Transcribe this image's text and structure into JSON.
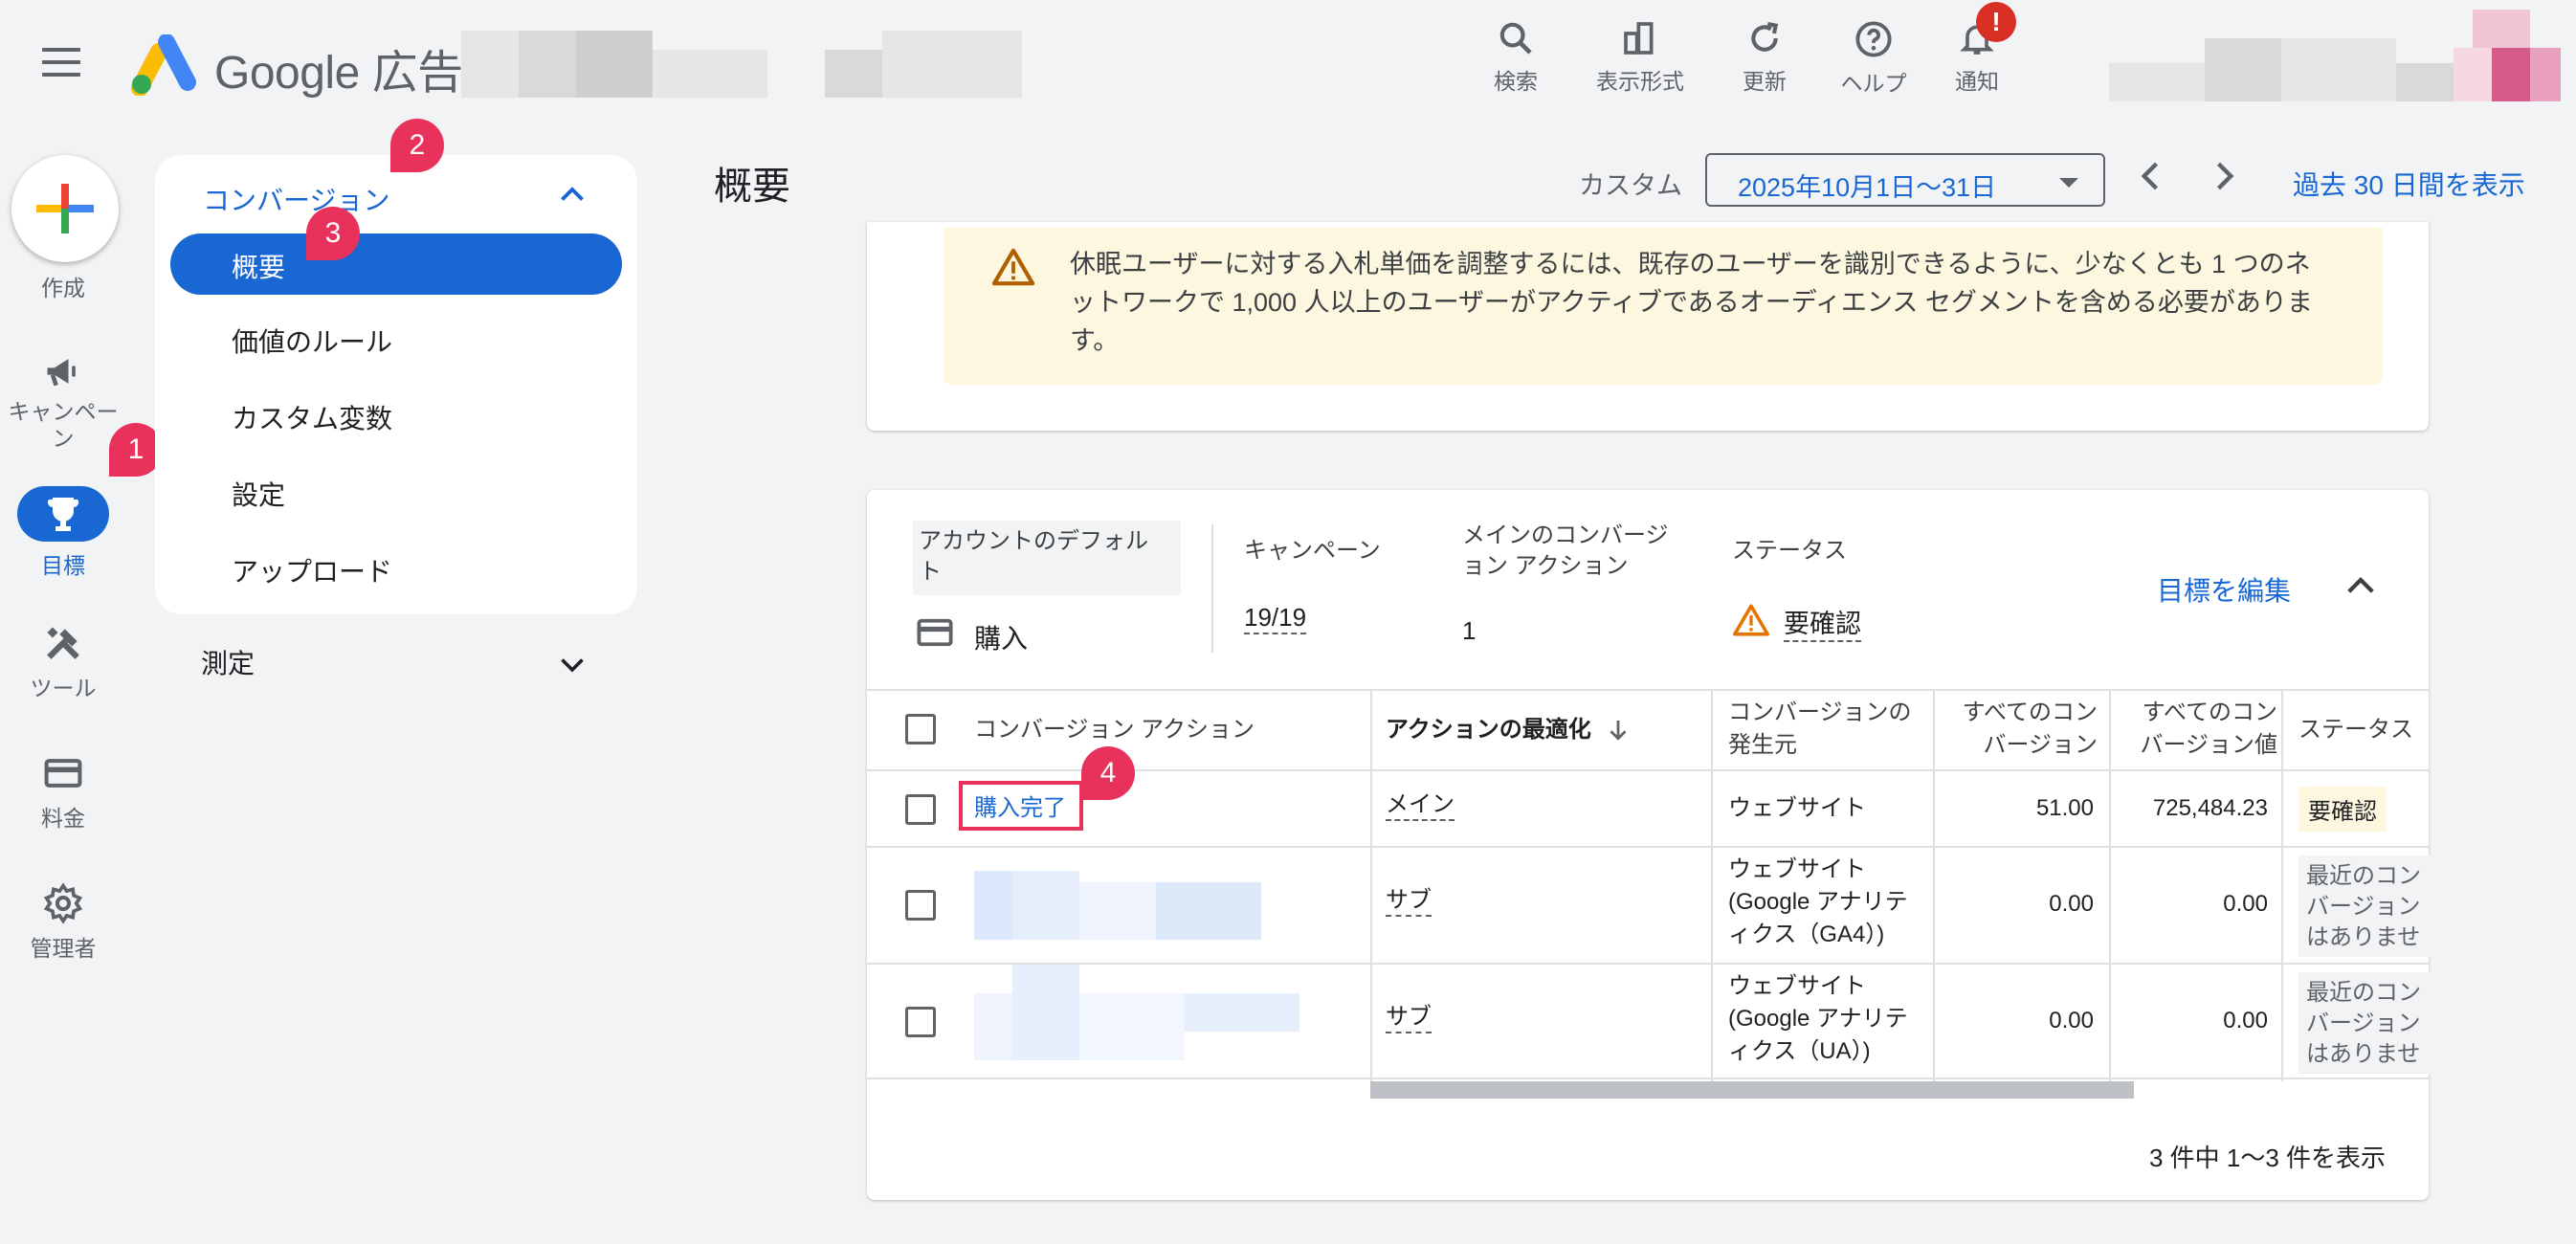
{
  "header": {
    "brand": "Google 広告",
    "tools": [
      {
        "label": "検索",
        "icon": "search-icon"
      },
      {
        "label": "表示形式",
        "icon": "view-format-icon"
      },
      {
        "label": "更新",
        "icon": "refresh-icon"
      },
      {
        "label": "ヘルプ",
        "icon": "help-icon"
      },
      {
        "label": "通知",
        "icon": "bell-icon"
      }
    ],
    "notification_badge": "!"
  },
  "rail": {
    "create": "作成",
    "campaign": "キャンペーン",
    "goals": "目標",
    "tools": "ツール",
    "billing": "料金",
    "admin": "管理者"
  },
  "nav": {
    "section": "コンバージョン",
    "items": [
      "概要",
      "価値のルール",
      "カスタム変数",
      "設定",
      "アップロード"
    ],
    "measure": "測定"
  },
  "badges": [
    "1",
    "2",
    "3",
    "4"
  ],
  "page": {
    "title": "概要",
    "custom_label": "カスタム",
    "date_range": "2025年10月1日〜31日",
    "past_link": "過去 30 日間を表示"
  },
  "warning": {
    "text": "休眠ユーザーに対する入札単価を調整するには、既存のユーザーを識別できるように、少なくとも 1 つのネットワークで 1,000 人以上のユーザーがアクティブであるオーディエンス セグメントを含める必要があります。"
  },
  "summary": {
    "default_label": "アカウントのデフォルト",
    "default_value": "購入",
    "campaign_label": "キャンペーン",
    "campaign_value": "19/19",
    "main_action_label": "メインのコンバージョン アクション",
    "main_action_value": "1",
    "status_label": "ステータス",
    "status_value": "要確認",
    "edit_goal": "目標を編集"
  },
  "table": {
    "headers": {
      "action": "コンバージョン アクション",
      "optimization": "アクションの最適化",
      "source": "コンバージョンの発生元",
      "all_conv": "すべてのコンバージョン",
      "all_conv_value": "すべてのコンバージョン値",
      "status": "ステータス"
    },
    "rows": [
      {
        "action": "購入完了",
        "optimization": "メイン",
        "source": "ウェブサイト",
        "all_conv": "51.00",
        "all_conv_value": "725,484.23",
        "status": "要確認"
      },
      {
        "action": "",
        "optimization": "サブ",
        "source": "ウェブサイト (Google アナリティクス（GA4）)",
        "all_conv": "0.00",
        "all_conv_value": "0.00",
        "status": "最近のコンバージョンはありません"
      },
      {
        "action": "",
        "optimization": "サブ",
        "source": "ウェブサイト (Google アナリティクス（UA）)",
        "all_conv": "0.00",
        "all_conv_value": "0.00",
        "status": "最近のコンバージョンはありません"
      }
    ],
    "footer": "3 件中 1〜3 件を表示"
  },
  "colors": {
    "accent": "#1967d2",
    "badge": "#e8315b",
    "warning_bg": "#fef7e0",
    "warning_icon": "#b06000"
  }
}
